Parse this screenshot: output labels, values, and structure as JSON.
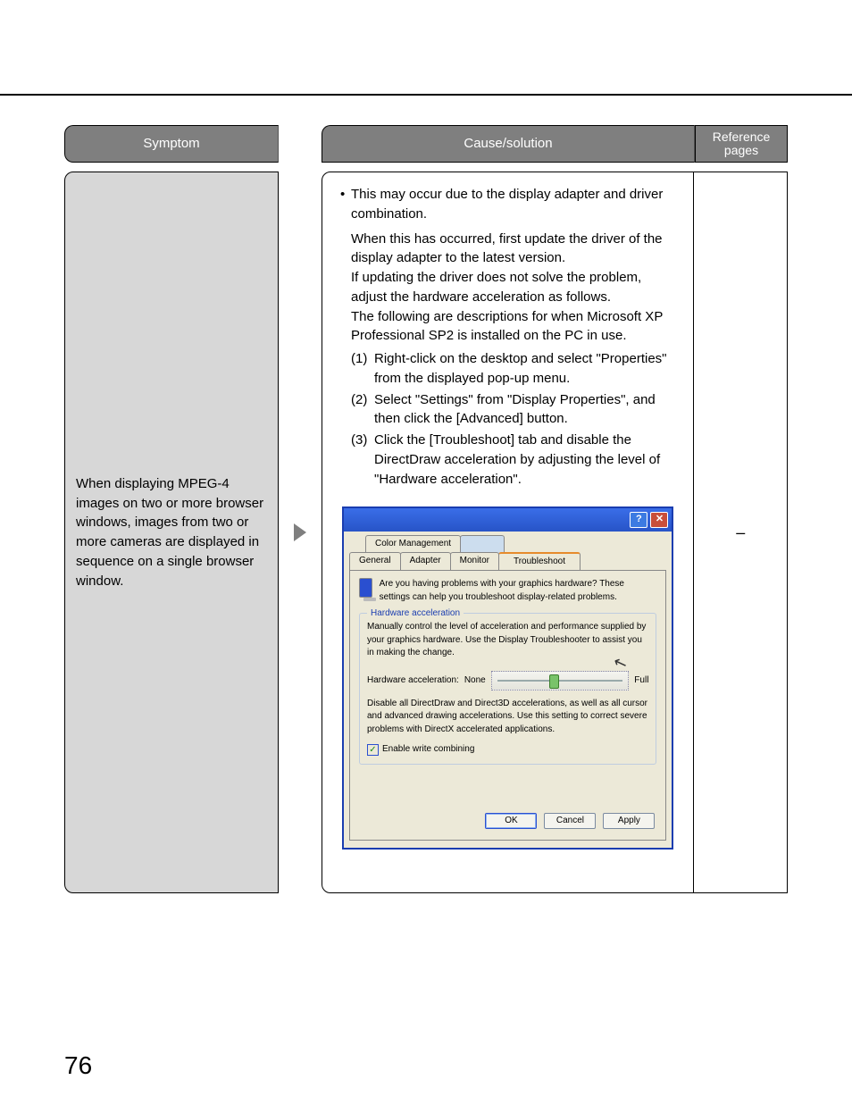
{
  "page_number": "76",
  "headers": {
    "symptom": "Symptom",
    "cause": "Cause/solution",
    "reference": "Reference pages"
  },
  "row": {
    "symptom_text": "When displaying MPEG-4 images on two or more browser windows, images from two or more cameras are displayed in sequence on a single browser window.",
    "reference_text": "–",
    "bullet_lead": "This may occur due to the display adapter and driver combination.",
    "para2": "When this has occurred, first update the driver of the display adapter to the latest version.",
    "para3": "If updating the driver does not solve the problem, adjust the hardware acceleration as follows.",
    "para4": "The following are descriptions for when Microsoft XP Professional SP2 is installed on the PC in use.",
    "steps": {
      "s1": "Right-click on the desktop and select \"Properties\" from the displayed pop-up menu.",
      "s2": "Select \"Settings\" from \"Display Properties\", and then click the [Advanced] button.",
      "s3": "Click the [Troubleshoot] tab and disable the DirectDraw acceleration by adjusting the level of \"Hardware acceleration\"."
    }
  },
  "dialog": {
    "tabs_row1": {
      "colorManagement": "Color Management"
    },
    "tabs_row2": {
      "general": "General",
      "adapter": "Adapter",
      "monitor": "Monitor",
      "troubleshoot": "Troubleshoot"
    },
    "intro": "Are you having problems with your graphics hardware? These settings can help you troubleshoot display-related problems.",
    "group_title": "Hardware acceleration",
    "group_desc": "Manually control the level of acceleration and performance supplied by your graphics hardware. Use the Display Troubleshooter to assist you in making the change.",
    "slider_label": "Hardware acceleration:",
    "slider_none": "None",
    "slider_full": "Full",
    "after_slider": "Disable all DirectDraw and Direct3D accelerations, as well as all cursor and advanced drawing accelerations. Use this setting to correct severe problems with DirectX accelerated applications.",
    "checkbox": "Enable write combining",
    "btn_ok": "OK",
    "btn_cancel": "Cancel",
    "btn_apply": "Apply"
  }
}
